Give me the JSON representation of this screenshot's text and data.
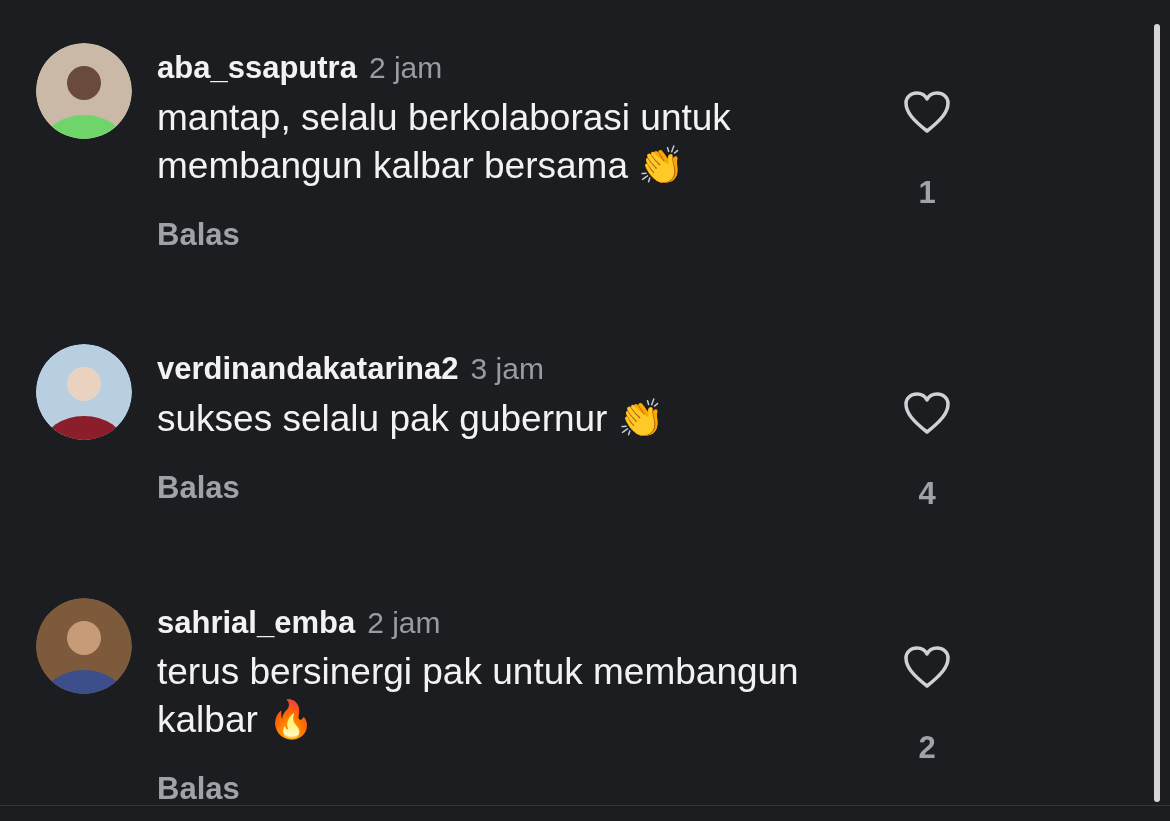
{
  "comments": [
    {
      "username": "aba_ssaputra",
      "time": "2 jam",
      "text": "mantap, selalu berkolaborasi untuk membangun kalbar bersama 👏",
      "reply": "Balas",
      "likes": "1",
      "liked": false
    },
    {
      "username": "verdinandakatarina2",
      "time": "3 jam",
      "text": "sukses selalu pak gubernur 👏",
      "reply": "Balas",
      "likes": "4",
      "liked": false
    },
    {
      "username": "sahrial_emba",
      "time": "2 jam",
      "text": "terus bersinergi pak untuk membangun kalbar 🔥",
      "reply": "Balas",
      "likes": "2",
      "liked": false
    }
  ]
}
